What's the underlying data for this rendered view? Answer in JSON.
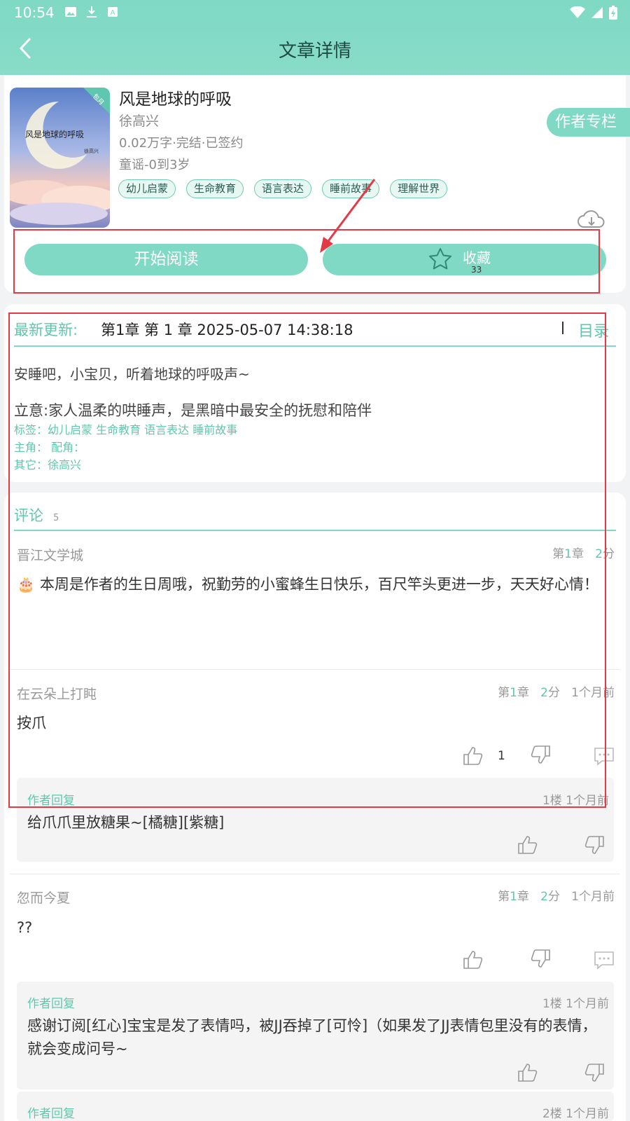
{
  "status": {
    "time": "10:54"
  },
  "header": {
    "title": "文章详情"
  },
  "book": {
    "title": "风是地球的呼吸",
    "author": "徐高兴",
    "meta": "0.02万字·完结·已签约",
    "genre": "童谣-0到3岁",
    "cover_title": "风是地球的呼吸",
    "cover_author": "徐高兴",
    "cover_badge": "包月",
    "tags": [
      "幼儿启蒙",
      "生命教育",
      "语言表达",
      "睡前故事",
      "理解世界"
    ],
    "author_column": "作者专栏",
    "read_button": "开始阅读",
    "favorite_label": "收藏",
    "favorite_count": "33"
  },
  "update": {
    "label": "最新更新:",
    "chapter": "第1章  第 1 章  2025-05-07 14:38:18",
    "toc": "目录",
    "summary": "安睡吧，小宝贝，听着地球的呼吸声~",
    "intent": "立意:家人温柔的哄睡声，是黑暗中最安全的抚慰和陪伴",
    "tags_line": "标签：幼儿启蒙  生命教育  语言表达  睡前故事",
    "roles_line": "主角：        配角：",
    "other_line": "其它：徐高兴"
  },
  "comments": {
    "title": "评论",
    "count": "5",
    "items": [
      {
        "user": "晋江文学城",
        "chapter_prefix": "第",
        "chapter_num": "1",
        "chapter_suffix": "章",
        "score_num": "2",
        "score_suffix": "分",
        "time": "",
        "text": "🎂 本周是作者的生日周哦，祝勤劳的小蜜蜂生日快乐，百尺竿头更进一步，天天好心情！"
      },
      {
        "user": "在云朵上打盹",
        "chapter_prefix": "第",
        "chapter_num": "1",
        "chapter_suffix": "章",
        "score_num": "2",
        "score_suffix": "分",
        "time": "1个月前",
        "text": "按爪",
        "likes": "1",
        "reply": {
          "label": "作者回复",
          "meta": "1楼  1个月前",
          "text": "给爪爪里放糖果~[橘糖][紫糖]"
        }
      },
      {
        "user": "忽而今夏",
        "chapter_prefix": "第",
        "chapter_num": "1",
        "chapter_suffix": "章",
        "score_num": "2",
        "score_suffix": "分",
        "time": "1个月前",
        "text": "??",
        "replies": [
          {
            "label": "作者回复",
            "meta": "1楼  1个月前",
            "text": "感谢订阅[红心]宝宝是发了表情吗，被JJ吞掉了[可怜]（如果发了JJ表情包里没有的表情，就会变成问号~"
          },
          {
            "label": "作者回复",
            "meta": "2楼  1个月前",
            "text": ""
          }
        ]
      }
    ]
  },
  "colors": {
    "accent": "#7fd9c4",
    "accent_text": "#5fc7ae",
    "annotation": "#e23b45"
  }
}
